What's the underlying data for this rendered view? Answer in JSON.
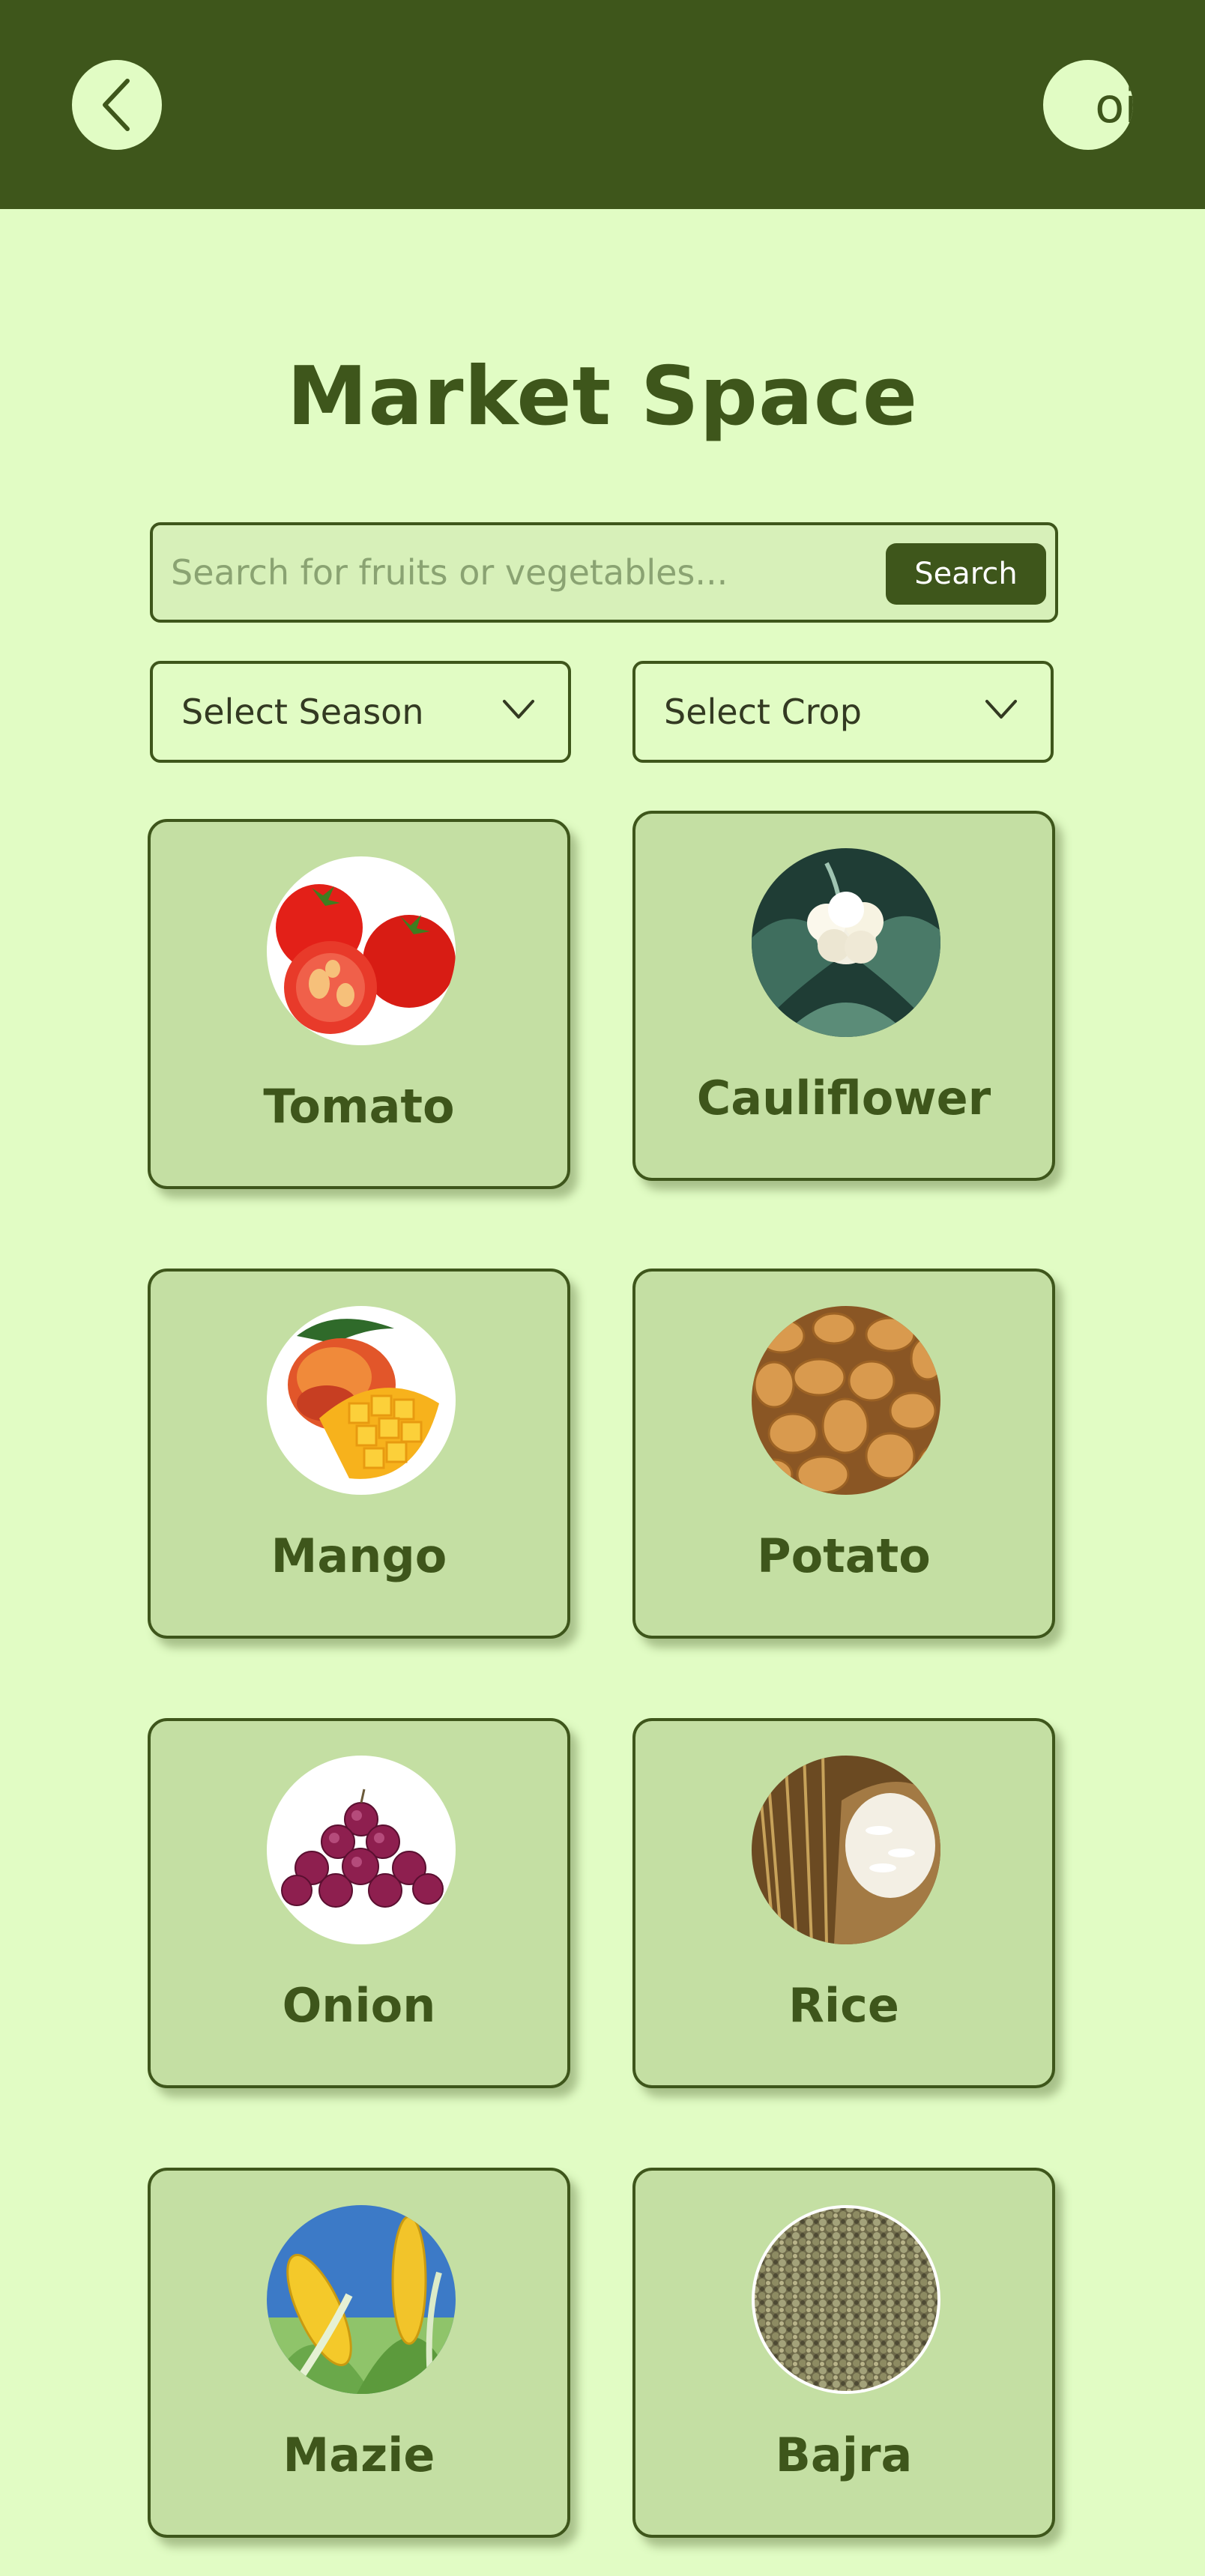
{
  "header": {
    "back_icon": "chevron-left-icon",
    "avatar_text": "oi"
  },
  "page": {
    "title": "Market Space"
  },
  "search": {
    "placeholder": "Search for fruits or vegetables...",
    "value": "",
    "button_label": "Search"
  },
  "filters": {
    "season": {
      "label": "Select Season",
      "icon": "chevron-down-icon"
    },
    "crop": {
      "label": "Select Crop",
      "icon": "chevron-down-icon"
    }
  },
  "crops": [
    {
      "name": "Tomato",
      "image": "tomato-image"
    },
    {
      "name": "Cauliflower",
      "image": "cauliflower-image"
    },
    {
      "name": "Mango",
      "image": "mango-image"
    },
    {
      "name": "Potato",
      "image": "potato-image"
    },
    {
      "name": "Onion",
      "image": "onion-image"
    },
    {
      "name": "Rice",
      "image": "rice-image"
    },
    {
      "name": "Mazie",
      "image": "maize-image"
    },
    {
      "name": "Bajra",
      "image": "bajra-image"
    }
  ],
  "colors": {
    "header_bg": "#3e561b",
    "page_bg": "#e1fcc4",
    "card_bg": "#c4dfa3",
    "accent": "#3e561b"
  }
}
